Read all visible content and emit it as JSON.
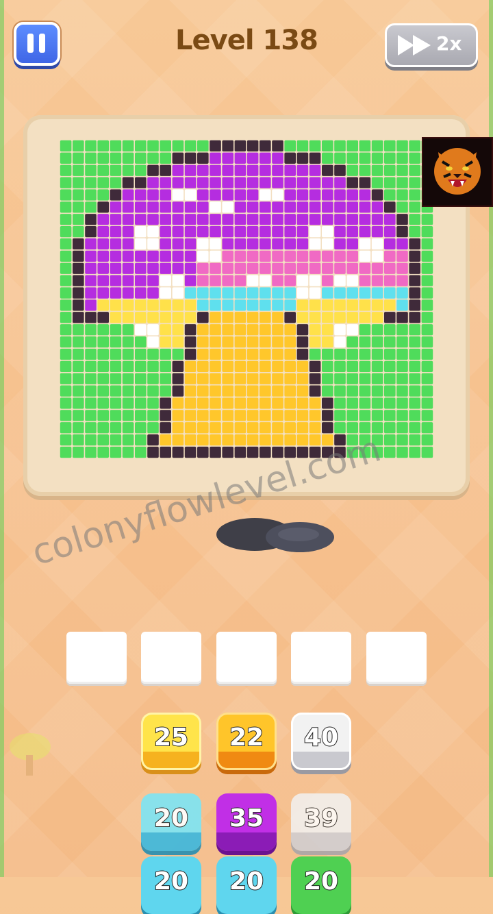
{
  "header": {
    "title": "Level 138",
    "speed_label": "2x"
  },
  "watermark": "colonyflowlevel.com",
  "slots": [
    {
      "index": 1,
      "value": ""
    },
    {
      "index": 2,
      "value": ""
    },
    {
      "index": 3,
      "value": ""
    },
    {
      "index": 4,
      "value": ""
    },
    {
      "index": 5,
      "value": ""
    }
  ],
  "tiles": [
    {
      "label": "25",
      "color": "yellow"
    },
    {
      "label": "22",
      "color": "orange"
    },
    {
      "label": "40",
      "color": "white"
    },
    {
      "label": "20",
      "color": "cyan"
    },
    {
      "label": "35",
      "color": "purple"
    },
    {
      "label": "39",
      "color": "white"
    },
    {
      "label": "20",
      "color": "cyan"
    },
    {
      "label": "20",
      "color": "cyan"
    },
    {
      "label": "20",
      "color": "green"
    }
  ],
  "colors": {
    "background": "#f6c08d",
    "board_green": "#4fdc5b",
    "mushroom_purple": "#b52de0",
    "mushroom_pink": "#f06ac4",
    "mushroom_cyan": "#5fe0ee",
    "stem_yellow": "#ffc72b",
    "outline": "#3f2a3a",
    "title": "#7a4a14",
    "pause_blue": "#4f79f2"
  },
  "icons": {
    "pause": "pause-icon",
    "fast_forward": "fast-forward-icon",
    "avatar": "tiger-avatar-icon"
  }
}
